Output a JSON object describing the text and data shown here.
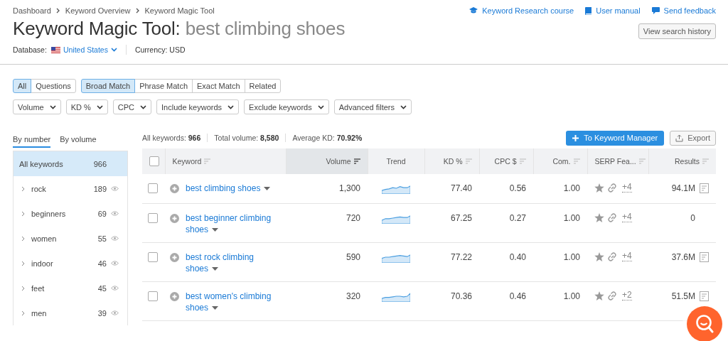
{
  "breadcrumbs": [
    "Dashboard",
    "Keyword Overview",
    "Keyword Magic Tool"
  ],
  "top_links": [
    {
      "kind": "course",
      "label": "Keyword Research course"
    },
    {
      "kind": "manual",
      "label": "User manual"
    },
    {
      "kind": "feedback",
      "label": "Send feedback"
    }
  ],
  "title": {
    "tool": "Keyword Magic Tool:",
    "query": "best climbing shoes"
  },
  "history_button": "View search history",
  "database": {
    "label": "Database:",
    "value": "United States"
  },
  "currency": "Currency: USD",
  "match_groups": [
    [
      {
        "label": "All",
        "selected": true
      },
      {
        "label": "Questions",
        "selected": false
      }
    ],
    [
      {
        "label": "Broad Match",
        "selected": true
      },
      {
        "label": "Phrase Match",
        "selected": false
      },
      {
        "label": "Exact Match",
        "selected": false
      },
      {
        "label": "Related",
        "selected": false
      }
    ]
  ],
  "filters": [
    "Volume",
    "KD %",
    "CPC",
    "Include keywords",
    "Exclude keywords",
    "Advanced filters"
  ],
  "group_tabs": [
    {
      "label": "By number",
      "selected": true
    },
    {
      "label": "By volume",
      "selected": false
    }
  ],
  "groups": [
    {
      "label": "All keywords",
      "count": "966",
      "selected": true,
      "expandable": false
    },
    {
      "label": "rock",
      "count": "189",
      "selected": false,
      "expandable": true
    },
    {
      "label": "beginners",
      "count": "69",
      "selected": false,
      "expandable": true
    },
    {
      "label": "women",
      "count": "55",
      "selected": false,
      "expandable": true
    },
    {
      "label": "indoor",
      "count": "46",
      "selected": false,
      "expandable": true
    },
    {
      "label": "feet",
      "count": "45",
      "selected": false,
      "expandable": true
    },
    {
      "label": "men",
      "count": "39",
      "selected": false,
      "expandable": true
    }
  ],
  "stats": [
    {
      "label": "All keywords:",
      "value": "966"
    },
    {
      "label": "Total volume:",
      "value": "8,580"
    },
    {
      "label": "Average KD:",
      "value": "70.92%"
    }
  ],
  "primary_button": "To Keyword Manager",
  "export_button": "Export",
  "table": {
    "select_all_checked": false,
    "columns": [
      {
        "label": "Keyword",
        "sorted": false
      },
      {
        "label": "Volume",
        "sorted": true
      },
      {
        "label": "Trend",
        "sorted": false
      },
      {
        "label": "KD %",
        "sorted": false
      },
      {
        "label": "CPC $",
        "sorted": false
      },
      {
        "label": "Com.",
        "sorted": false
      },
      {
        "label": "SERP Fea...",
        "sorted": false
      },
      {
        "label": "Results",
        "sorted": false
      }
    ],
    "rows": [
      {
        "checked": false,
        "keyword": "best climbing shoes",
        "volume": "1,300",
        "kd": "77.40",
        "cpc": "0.56",
        "com": "1.00",
        "serp_more": "+4",
        "results": "94.1M",
        "serp_link": true
      },
      {
        "checked": false,
        "keyword": "best beginner climbing shoes",
        "volume": "720",
        "kd": "67.25",
        "cpc": "0.27",
        "com": "1.00",
        "serp_more": "+4",
        "results": "0",
        "serp_link": false
      },
      {
        "checked": false,
        "keyword": "best rock climbing shoes",
        "volume": "590",
        "kd": "77.22",
        "cpc": "0.40",
        "com": "1.00",
        "serp_more": "+4",
        "results": "37.6M",
        "serp_link": true
      },
      {
        "checked": false,
        "keyword": "best women's climbing shoes",
        "volume": "320",
        "kd": "70.36",
        "cpc": "0.46",
        "com": "1.00",
        "serp_more": "+2",
        "results": "51.5M",
        "serp_link": true
      }
    ]
  }
}
